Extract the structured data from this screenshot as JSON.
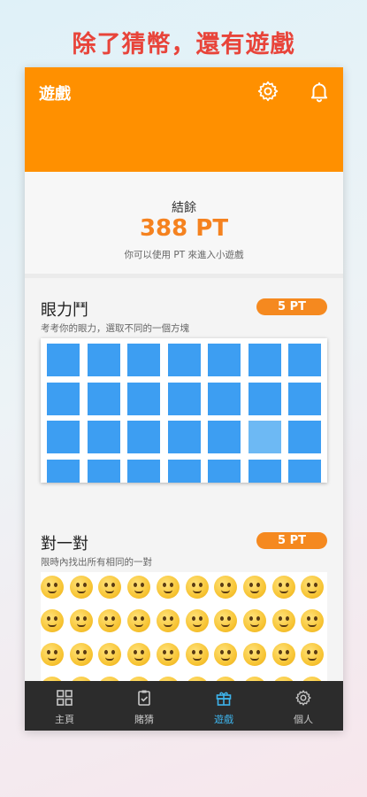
{
  "headline": "除了猜幣，還有遊戲",
  "app_bar": {
    "title": "遊戲"
  },
  "balance": {
    "label": "結餘",
    "value": "388 PT",
    "hint": "你可以使用 PT 來進入小遊戲"
  },
  "games": [
    {
      "title": "眼力鬥",
      "subtitle": "考考你的眼力，選取不同的一個方塊",
      "cost": "5 PT"
    },
    {
      "title": "對一對",
      "subtitle": "限時內找出所有相同的一對",
      "cost": "5 PT"
    }
  ],
  "tabs": [
    {
      "label": "主頁",
      "icon": "home-grid-icon"
    },
    {
      "label": "賭猜",
      "icon": "clipboard-check-icon"
    },
    {
      "label": "遊戲",
      "icon": "gift-icon",
      "active": true
    },
    {
      "label": "個人",
      "icon": "gear-icon"
    }
  ],
  "colors": {
    "accent": "#ff9000",
    "tile": "#3d9ef2",
    "tile_odd": "#6db9f4",
    "tab_active": "#3eb4ec",
    "headline": "#e8443a"
  }
}
